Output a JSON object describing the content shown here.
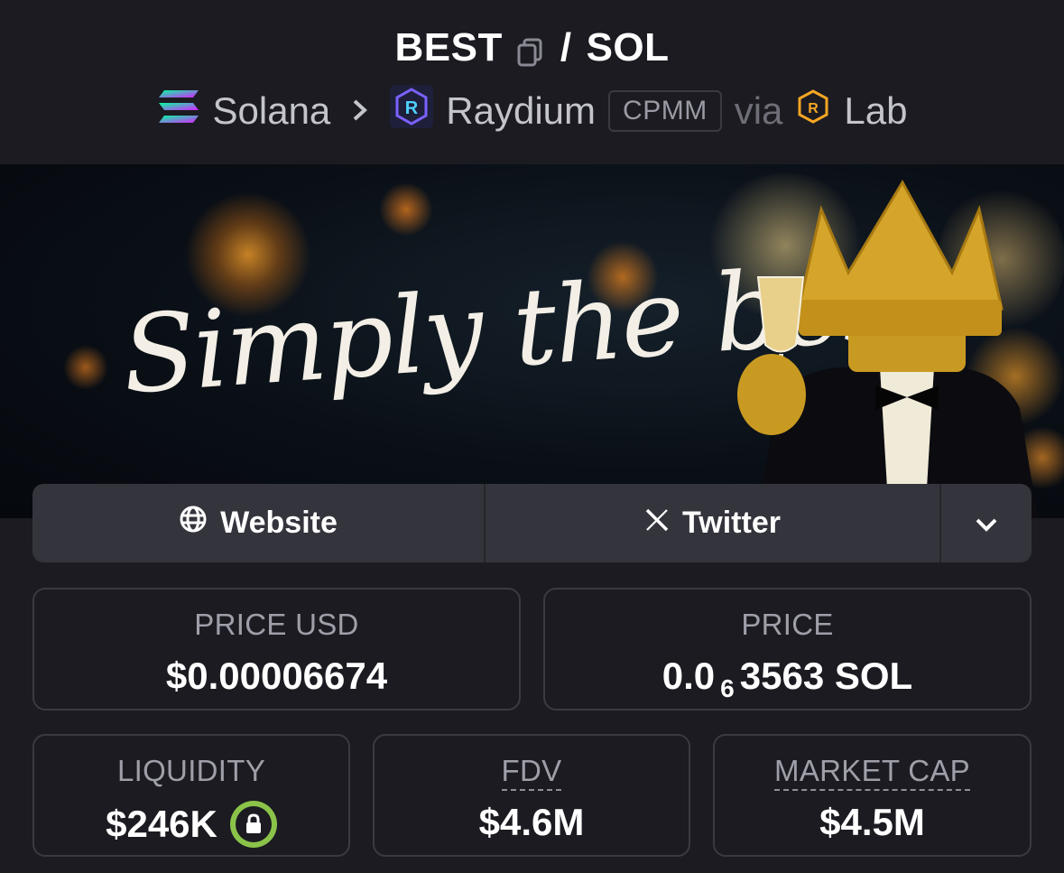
{
  "header": {
    "base_token": "BEST",
    "separator": "/",
    "quote_token": "SOL",
    "chain": "Solana",
    "dex": "Raydium",
    "pool_type": "CPMM",
    "via": "via",
    "launchpad": "Lab"
  },
  "banner": {
    "text": "Simply the best."
  },
  "socials": {
    "website_label": "Website",
    "twitter_label": "Twitter"
  },
  "stats": {
    "price_usd_label": "PRICE USD",
    "price_usd_value": "$0.00006674",
    "price_label": "PRICE",
    "price_prefix": "0.0",
    "price_zero_count": "6",
    "price_suffix": "3563 SOL",
    "liquidity_label": "LIQUIDITY",
    "liquidity_value": "$246K",
    "fdv_label": "FDV",
    "fdv_value": "$4.6M",
    "market_cap_label": "MARKET CAP",
    "market_cap_value": "$4.5M"
  },
  "colors": {
    "background": "#1b1b21",
    "card_border": "#3a3a44",
    "lock_green": "#8bc34a",
    "raydium_accent": "#7b61ff",
    "lab_accent": "#f5a623"
  },
  "icons": {
    "copy": "copy-icon",
    "solana": "solana-icon",
    "raydium": "raydium-icon",
    "lab": "lab-icon",
    "globe": "globe-icon",
    "twitter": "x-icon",
    "more": "chevron-down-icon",
    "lock": "lock-icon"
  }
}
